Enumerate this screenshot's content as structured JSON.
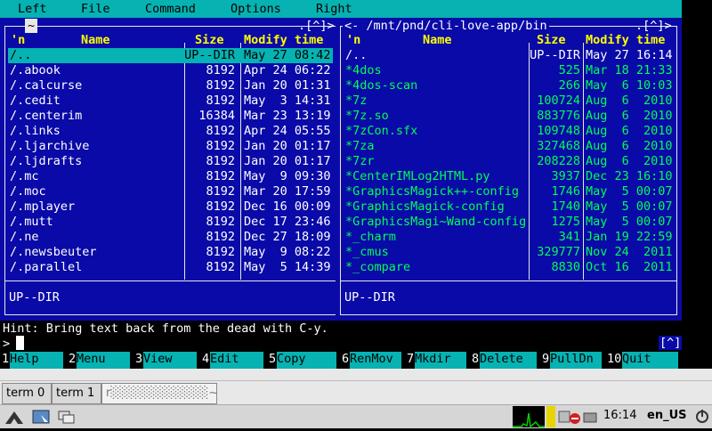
{
  "menu": {
    "left": "Left",
    "file": "File",
    "command": "Command",
    "options": "Options",
    "right": "Right"
  },
  "left_panel": {
    "tab_label": "~",
    "scroll_marker": ".[^]>",
    "header": {
      "n": "'n",
      "name": "Name",
      "size": "Size",
      "modify": "Modify time"
    },
    "rows": [
      {
        "name": "/..",
        "size": "UP--DIR",
        "date": "May 27 08:42",
        "selected": true
      },
      {
        "name": "/.abook",
        "size": "8192",
        "date": "Apr 24 06:22"
      },
      {
        "name": "/.calcurse",
        "size": "8192",
        "date": "Jan 20 01:31"
      },
      {
        "name": "/.cedit",
        "size": "8192",
        "date": "May  3 14:31"
      },
      {
        "name": "/.centerim",
        "size": "16384",
        "date": "Mar 23 13:19"
      },
      {
        "name": "/.links",
        "size": "8192",
        "date": "Apr 24 05:55"
      },
      {
        "name": "/.ljarchive",
        "size": "8192",
        "date": "Jan 20 01:17"
      },
      {
        "name": "/.ljdrafts",
        "size": "8192",
        "date": "Jan 20 01:17"
      },
      {
        "name": "/.mc",
        "size": "8192",
        "date": "May  9 09:30"
      },
      {
        "name": "/.moc",
        "size": "8192",
        "date": "Mar 20 17:59"
      },
      {
        "name": "/.mplayer",
        "size": "8192",
        "date": "Dec 16 00:09"
      },
      {
        "name": "/.mutt",
        "size": "8192",
        "date": "Dec 17 23:46"
      },
      {
        "name": "/.ne",
        "size": "8192",
        "date": "Dec 27 18:09"
      },
      {
        "name": "/.newsbeuter",
        "size": "8192",
        "date": "May  9 08:22"
      },
      {
        "name": "/.parallel",
        "size": "8192",
        "date": "May  5 14:39"
      }
    ],
    "status": "UP--DIR"
  },
  "right_panel": {
    "path": "<- /mnt/pnd/cli-love-app/bin",
    "scroll_marker": ".[^]>",
    "header": {
      "n": "'n",
      "name": "Name",
      "size": "Size",
      "modify": "Modify time"
    },
    "rows": [
      {
        "name": "/..",
        "size": "UP--DIR",
        "date": "May 27 16:14",
        "color": "white"
      },
      {
        "name": "*4dos",
        "size": "525",
        "date": "Mar 18 21:33",
        "color": "green"
      },
      {
        "name": "*4dos-scan",
        "size": "266",
        "date": "May  6 10:03",
        "color": "green"
      },
      {
        "name": "*7z",
        "size": "100724",
        "date": "Aug  6  2010",
        "color": "green"
      },
      {
        "name": "*7z.so",
        "size": "883776",
        "date": "Aug  6  2010",
        "color": "green"
      },
      {
        "name": "*7zCon.sfx",
        "size": "109748",
        "date": "Aug  6  2010",
        "color": "green"
      },
      {
        "name": "*7za",
        "size": "327468",
        "date": "Aug  6  2010",
        "color": "green"
      },
      {
        "name": "*7zr",
        "size": "208228",
        "date": "Aug  6  2010",
        "color": "green"
      },
      {
        "name": "*CenterIMLog2HTML.py",
        "size": "3937",
        "date": "Dec 23 16:10",
        "color": "green"
      },
      {
        "name": "*GraphicsMagick++-config",
        "size": "1746",
        "date": "May  5 00:07",
        "color": "green"
      },
      {
        "name": "*GraphicsMagick-config",
        "size": "1740",
        "date": "May  5 00:07",
        "color": "green"
      },
      {
        "name": "*GraphicsMagi~Wand-config",
        "size": "1275",
        "date": "May  5 00:07",
        "color": "green"
      },
      {
        "name": "*_charm",
        "size": "341",
        "date": "Jan 19 22:59",
        "color": "green"
      },
      {
        "name": "*_cmus",
        "size": "329777",
        "date": "Nov 24  2011",
        "color": "green"
      },
      {
        "name": "*_compare",
        "size": "8830",
        "date": "Oct 16  2011",
        "color": "green"
      }
    ],
    "status": "UP--DIR"
  },
  "hint": "Hint: Bring text back from the dead with C-y.",
  "prompt": ">",
  "cmd_marker": "[^]",
  "fkeys": [
    {
      "num": "1",
      "label": "Help"
    },
    {
      "num": "2",
      "label": "Menu"
    },
    {
      "num": "3",
      "label": "View"
    },
    {
      "num": "4",
      "label": "Edit"
    },
    {
      "num": "5",
      "label": "Copy"
    },
    {
      "num": "6",
      "label": "RenMov"
    },
    {
      "num": "7",
      "label": "Mkdir"
    },
    {
      "num": "8",
      "label": "Delete"
    },
    {
      "num": "9",
      "label": "PullDn"
    },
    {
      "num": "10",
      "label": "Quit"
    }
  ],
  "terminal_tabs": [
    {
      "label": "term 0"
    },
    {
      "label": "term 1"
    },
    {
      "label": "r░░░░░░░░░░░~"
    }
  ],
  "tray": {
    "clock": "16:14",
    "locale": "en_US"
  },
  "colors": {
    "panel_bg": "#0a0aa8",
    "accent": "#06b2b2",
    "exec": "#00ff55",
    "header": "#ffff00"
  }
}
